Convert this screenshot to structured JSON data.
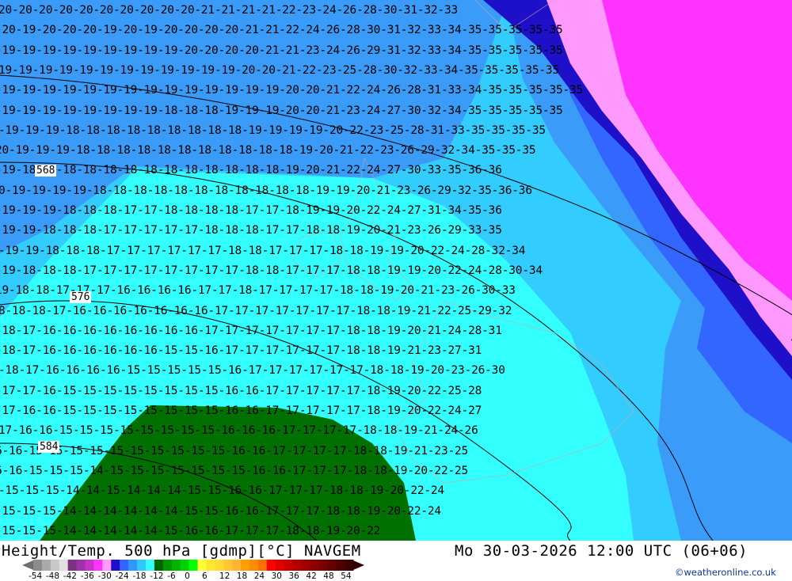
{
  "title": "Height/Temp. 500 hPa [gdmp][°C] NAVGEM",
  "datetime": "Mo 30-03-2026 12:00 UTC (06+06)",
  "credit": "©weatheronline.co.uk",
  "legend": {
    "colors": [
      "#8c8c8c",
      "#aaaaaa",
      "#c8c8c8",
      "#e1e1e1",
      "#7a3282",
      "#a032a8",
      "#c832c8",
      "#ff32ff",
      "#ff9bff",
      "#1e0fc8",
      "#3264ff",
      "#3296ff",
      "#32c8ff",
      "#32ffff",
      "#006400",
      "#009600",
      "#00b400",
      "#00d200",
      "#00ff00",
      "#ffff32",
      "#ffe632",
      "#ffdc32",
      "#ffc832",
      "#ffb432",
      "#ffa000",
      "#ff8c00",
      "#ff6e00",
      "#ff0000",
      "#e10000",
      "#c80000",
      "#b40000",
      "#a00000",
      "#8c0000",
      "#780000",
      "#640000",
      "#500000",
      "#3c0000"
    ],
    "ticks": [
      "-54",
      "-48",
      "-42",
      "-36",
      "-30",
      "-24",
      "-18",
      "-12",
      "-6",
      "0",
      "6",
      "12",
      "18",
      "24",
      "30",
      "36",
      "42",
      "48",
      "54"
    ]
  },
  "map": {
    "colors": {
      "t_m19": "#3a9cf8",
      "t_m18": "#33ccff",
      "t_m17": "#33ffff",
      "green": "#007000",
      "t_m22": "#3366ff",
      "t_m25": "#1e0fc8",
      "t_m30": "#ff99ff",
      "t_m33": "#ff33ff"
    },
    "height_labels": [
      "568",
      "576",
      "584"
    ],
    "contour_rows": [
      "20-20-20-20-20-20-20-20-20-20-21-21-21-21-22-23-24-26-28-30-31-32-33",
      "-20-19-20-20-20-19-20-19-20-20-20-20-21-21-22-24-26-28-30-31-32-33-34-35-35-35-35-35",
      "-19-19-19-19-19-19-19-19-19-20-20-20-20-21-21-23-24-26-29-31-32-33-34-35-35-35-35-35",
      "19-19-19-19-19-19-19-19-19-19-19-19-20-20-21-22-23-25-28-30-32-33-34-35-35-35-35-35",
      "-19-19-19-19-19-19-19-19-19-19-19-19-19-19-20-20-21-22-24-26-28-31-33-34-35-35-35-35-35",
      "-19-19-19-19-19-19-19-19-18-18-18-19-19-19-20-20-21-23-24-27-30-32-34-35-35-35-35-35",
      "-19-19-19-18-18-18-18-18-18-18-18-18-19-19-19-19-20-22-23-25-28-31-33-35-35-35-35",
      "20-19-19-19-18-18-18-18-18-18-18-18-18-18-18-19-20-21-22-23-26-29-32-34-35-35-35",
      "-19-18-18-18-18-18-18-18-18-18-18-18-18-18-19-20-21-22-24-27-30-33-35-36-36",
      "0-19-19-19-19-18-18-18-18-18-18-18-18-18-18-18-19-19-20-21-23-26-29-32-35-36-36",
      "-19-19-19-18-18-18-17-17-18-18-18-18-17-17-18-19-19-20-22-24-27-31-34-35-36",
      "-19-19-18-18-18-17-17-17-17-17-18-18-18-17-17-18-18-19-20-21-23-26-29-33-35",
      "-19-19-18-18-18-17-17-17-17-17-17-18-18-17-17-17-18-18-19-19-20-22-24-28-32-34",
      "-19-18-18-18-17-17-17-17-17-17-17-17-18-18-17-17-17-18-18-19-19-20-22-24-28-30-34",
      "19-18-18-17-17-17-16-16-16-16-17-17-18-17-17-17-17-18-18-19-20-21-23-26-30-33",
      "8-18-18-17-16-16-16-16-16-16-16-17-17-17-17-17-17-17-18-18-19-21-22-25-29-32",
      "-18-17-16-16-16-16-16-16-16-16-17-17-17-17-17-17-17-18-18-19-20-21-24-28-31",
      "-18-17-16-16-16-16-16-16-15-15-16-17-17-17-17-17-17-18-18-19-21-23-27-31",
      "-18-17-16-16-16-16-15-15-15-15-15-16-17-17-17-17-17-17-18-18-19-20-23-26-30",
      "-17-17-16-15-15-15-15-15-15-15-15-16-16-17-17-17-17-17-18-19-20-22-25-28",
      "-17-16-16-15-15-15-15-15-15-15-15-16-16-17-17-17-17-17-18-19-20-22-24-27",
      "17-16-16-15-15-15-15-15-15-15-15-16-16-16-17-17-17-17-18-18-19-21-24-26",
      "6-16-15-15-15-15-15-15-15-15-15-15-16-16-17-17-17-17-18-18-19-21-23-25",
      "6-16-15-15-15-14-15-15-15-15-15-15-15-16-16-17-17-17-18-18-19-20-22-25",
      "-15-15-15-14-14-15-14-14-14-15-15-16-16-17-17-17-18-18-19-20-22-24",
      "-15-15-15-14-14-14-14-14-14-15-15-16-16-17-17-17-18-18-19-20-22-24",
      "-15-15-15-14-14-14-14-14-15-16-16-17-17-17-18-18-19-20-22"
    ]
  }
}
